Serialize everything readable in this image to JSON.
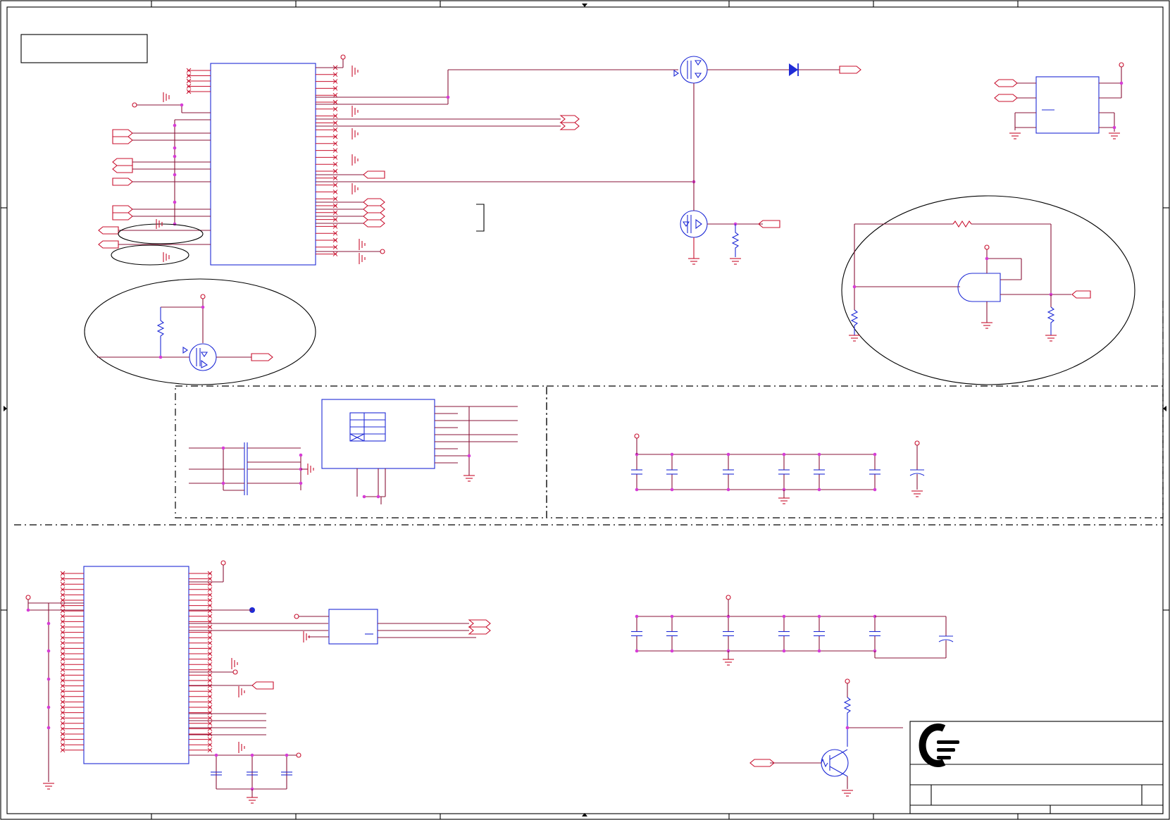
{
  "sheet": {
    "frame_color": "#000000",
    "wire_color": "#c8102e",
    "component_color": "#1f2bd6",
    "junction_color": "#d63cd6"
  },
  "title_block": {
    "logo": "company-logo-icon",
    "title": "",
    "sheet_number": ""
  },
  "blocks": {
    "main_ic": "main-ic-top",
    "secondary_ic": "main-ic-bottom",
    "regulator": "regulator-ic",
    "connector": "connector-block",
    "gate": "and-gate"
  }
}
